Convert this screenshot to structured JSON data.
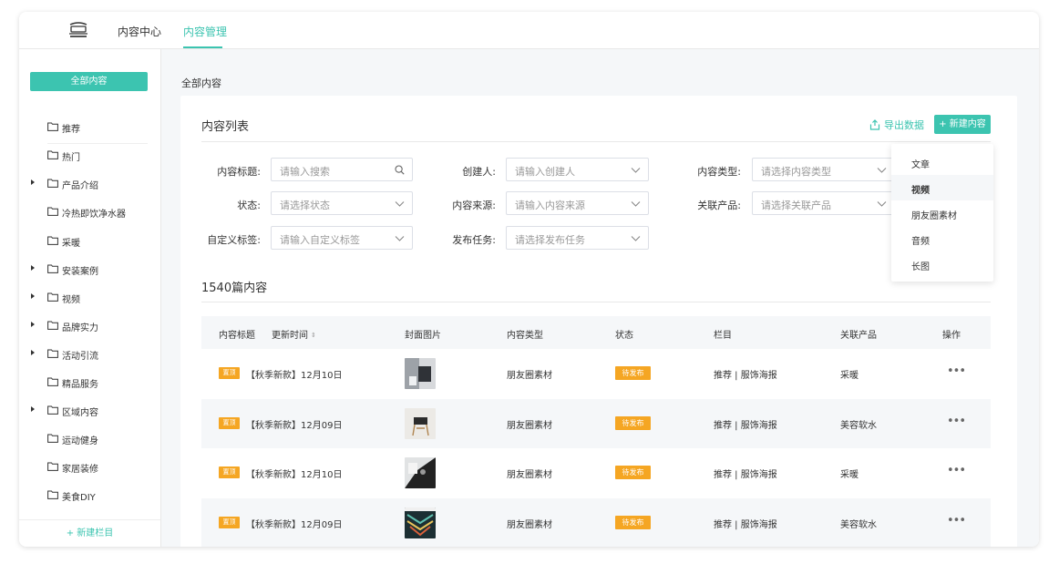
{
  "topnav": {
    "logo_icon": "brand-logo-icon",
    "items": [
      {
        "label": "内容中心",
        "active": false
      },
      {
        "label": "内容管理",
        "active": true
      }
    ]
  },
  "sidebar": {
    "all_button": "全部内容",
    "items": [
      {
        "label": "推荐",
        "expandable": false
      },
      {
        "label": "热门",
        "expandable": false
      },
      {
        "label": "产品介绍",
        "expandable": true
      },
      {
        "label": "冷热即饮净水器",
        "expandable": false
      },
      {
        "label": "采暖",
        "expandable": false
      },
      {
        "label": "安装案例",
        "expandable": true
      },
      {
        "label": "视频",
        "expandable": true
      },
      {
        "label": "品牌实力",
        "expandable": true
      },
      {
        "label": "活动引流",
        "expandable": true
      },
      {
        "label": "精品服务",
        "expandable": false
      },
      {
        "label": "区域内容",
        "expandable": true
      },
      {
        "label": "运动健身",
        "expandable": false
      },
      {
        "label": "家居装修",
        "expandable": false
      },
      {
        "label": "美食DIY",
        "expandable": false
      }
    ],
    "footer": "+ 新建栏目"
  },
  "main": {
    "breadcrumb": "全部内容",
    "card_title": "内容列表",
    "export_label": "导出数据",
    "new_button": "+ 新建内容",
    "filters": {
      "title": {
        "label": "内容标题:",
        "placeholder": "请输入搜索"
      },
      "creator": {
        "label": "创建人:",
        "placeholder": "请输入创建人"
      },
      "type": {
        "label": "内容类型:",
        "placeholder": "请选择内容类型"
      },
      "status": {
        "label": "状态:",
        "placeholder": "请选择状态"
      },
      "source": {
        "label": "内容来源:",
        "placeholder": "请输入内容来源"
      },
      "product": {
        "label": "关联产品:",
        "placeholder": "请选择关联产品"
      },
      "tag": {
        "label": "自定义标签:",
        "placeholder": "请输入自定义标签"
      },
      "task": {
        "label": "发布任务:",
        "placeholder": "请选择发布任务"
      }
    },
    "count_text": "1540篇内容",
    "table": {
      "headers": {
        "title": "内容标题",
        "updated": "更新时间",
        "cover": "封面图片",
        "type": "内容类型",
        "status": "状态",
        "column": "栏目",
        "product": "关联产品",
        "action": "操作"
      },
      "rows": [
        {
          "tag": "置顶",
          "title": "【秋季新款】12月10日",
          "type": "朋友圈素材",
          "status": "待发布",
          "column": "推荐 | 服饰海报",
          "product": "采暖"
        },
        {
          "tag": "置顶",
          "title": "【秋季新款】12月09日",
          "type": "朋友圈素材",
          "status": "待发布",
          "column": "推荐 | 服饰海报",
          "product": "美容软水"
        },
        {
          "tag": "置顶",
          "title": "【秋季新款】12月10日",
          "type": "朋友圈素材",
          "status": "待发布",
          "column": "推荐 | 服饰海报",
          "product": "采暖"
        },
        {
          "tag": "置顶",
          "title": "【秋季新款】12月09日",
          "type": "朋友圈素材",
          "status": "待发布",
          "column": "推荐 | 服饰海报",
          "product": "美容软水"
        }
      ],
      "more_glyph": "•••"
    }
  },
  "dropdown": {
    "options": [
      "文章",
      "视频",
      "朋友圈素材",
      "音频",
      "长图"
    ],
    "hovered": "视频"
  },
  "colors": {
    "accent": "#3cc4b0",
    "warning": "#f5a623"
  }
}
